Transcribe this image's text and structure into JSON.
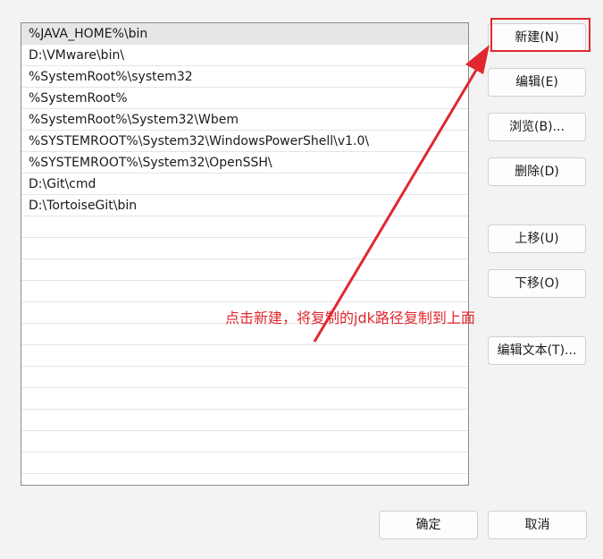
{
  "path_list": {
    "items": [
      "%JAVA_HOME%\\bin",
      "D:\\VMware\\bin\\",
      "%SystemRoot%\\system32",
      "%SystemRoot%",
      "%SystemRoot%\\System32\\Wbem",
      "%SYSTEMROOT%\\System32\\WindowsPowerShell\\v1.0\\",
      "%SYSTEMROOT%\\System32\\OpenSSH\\",
      "D:\\Git\\cmd",
      "D:\\TortoiseGit\\bin"
    ],
    "selected_index": 0
  },
  "side_buttons": {
    "new": "新建(N)",
    "edit": "编辑(E)",
    "browse": "浏览(B)...",
    "delete": "删除(D)",
    "move_up": "上移(U)",
    "move_down": "下移(O)",
    "edit_text": "编辑文本(T)..."
  },
  "footer_buttons": {
    "ok": "确定",
    "cancel": "取消"
  },
  "annotation": {
    "text": "点击新建，将复制的jdk路径复制到上面",
    "color": "#e0282e"
  }
}
